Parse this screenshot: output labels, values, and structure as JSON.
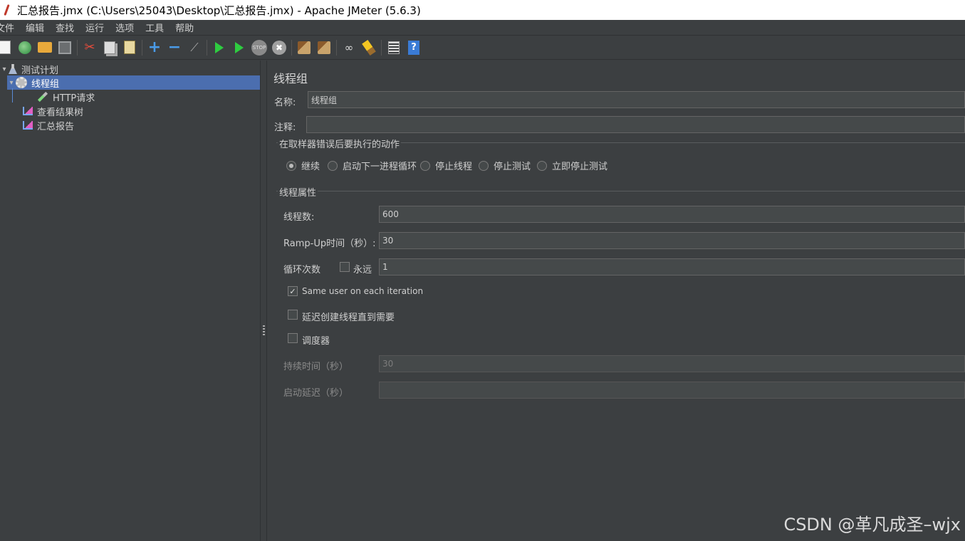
{
  "window": {
    "title": "汇总报告.jmx (C:\\Users\\25043\\Desktop\\汇总报告.jmx) - Apache JMeter (5.6.3)"
  },
  "menu": [
    "文件",
    "编辑",
    "查找",
    "运行",
    "选项",
    "工具",
    "帮助"
  ],
  "toolbar": [
    "new-icon",
    "templates-icon",
    "open-icon",
    "save-icon",
    "cut-icon",
    "copy-icon",
    "paste-icon",
    "expand-icon",
    "collapse-icon",
    "toggle-icon",
    "start-icon",
    "start-no-pauses-icon",
    "stop-icon",
    "shutdown-icon",
    "clear-icon",
    "clear-all-icon",
    "search-icon",
    "reset-search-icon",
    "function-helper-icon",
    "help-icon"
  ],
  "tree": {
    "test_plan": "测试计划",
    "thread_group": "线程组",
    "http_request": "HTTP请求",
    "view_results_tree": "查看结果树",
    "summary_report": "汇总报告"
  },
  "panel": {
    "title": "线程组",
    "name_label": "名称:",
    "name_value": "线程组",
    "comment_label": "注释:",
    "comment_value": "",
    "error_action_title": "在取样器错误后要执行的动作",
    "error_actions": {
      "continue": "继续",
      "next_loop": "启动下一进程循环",
      "stop_thread": "停止线程",
      "stop_test": "停止测试",
      "stop_test_now": "立即停止测试"
    },
    "selected_action": "继续",
    "thread_props_title": "线程属性",
    "threads_label": "线程数:",
    "threads_value": "600",
    "rampup_label": "Ramp-Up时间（秒）:",
    "rampup_value": "30",
    "loop_label": "循环次数",
    "forever_label": "永远",
    "forever_checked": false,
    "loop_value": "1",
    "same_user_label": "Same user on each iteration",
    "same_user_checked": true,
    "delay_label": "延迟创建线程直到需要",
    "delay_checked": false,
    "scheduler_label": "调度器",
    "scheduler_checked": false,
    "duration_label": "持续时间（秒）",
    "duration_value": "30",
    "startup_delay_label": "启动延迟（秒）",
    "startup_delay_value": ""
  },
  "watermark": "CSDN @革凡成圣–wjx"
}
